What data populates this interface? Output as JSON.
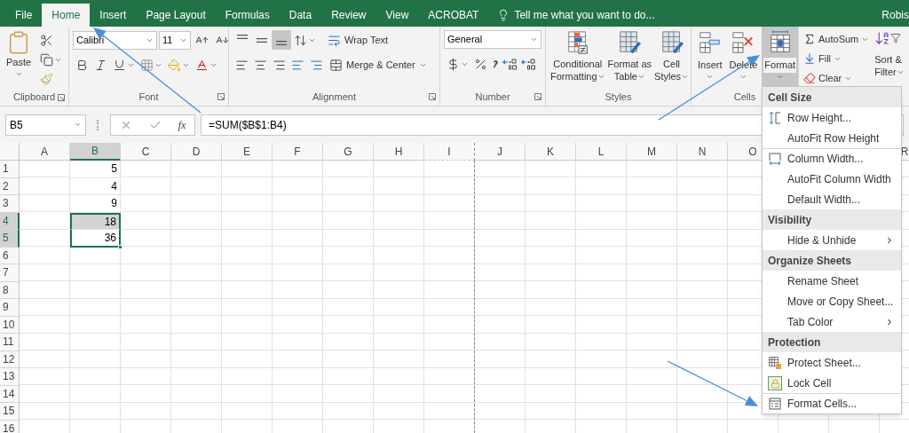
{
  "tabs": [
    {
      "label": "File",
      "selected": false
    },
    {
      "label": "Home",
      "selected": true
    },
    {
      "label": "Insert",
      "selected": false
    },
    {
      "label": "Page Layout",
      "selected": false
    },
    {
      "label": "Formulas",
      "selected": false
    },
    {
      "label": "Data",
      "selected": false
    },
    {
      "label": "Review",
      "selected": false
    },
    {
      "label": "View",
      "selected": false
    },
    {
      "label": "ACROBAT",
      "selected": false
    }
  ],
  "tell_me": {
    "placeholder": "Tell me what you want to do..."
  },
  "user": "Robis",
  "ribbon": {
    "clipboard": {
      "label": "Clipboard",
      "paste": "Paste"
    },
    "font": {
      "label": "Font",
      "font_name": "Calibri",
      "font_size": "11"
    },
    "alignment": {
      "label": "Alignment",
      "wrap_text": "Wrap Text",
      "merge": "Merge & Center",
      "vertical_align": [
        {
          "selected": false
        },
        {
          "selected": false
        },
        {
          "selected": true
        }
      ]
    },
    "number": {
      "label": "Number",
      "format": "General"
    },
    "styles": {
      "label": "Styles",
      "buttons": [
        {
          "lines": [
            "Conditional",
            "Formatting"
          ]
        },
        {
          "lines": [
            "Format as",
            "Table"
          ]
        },
        {
          "lines": [
            "Cell",
            "Styles"
          ]
        }
      ]
    },
    "cells": {
      "label": "Cells",
      "buttons": [
        {
          "label": "Insert",
          "selected": false
        },
        {
          "label": "Delete",
          "selected": false
        },
        {
          "label": "Format",
          "selected": true
        }
      ]
    },
    "editing": {
      "buttons": [
        {
          "label": "AutoSum"
        },
        {
          "label": "Fill"
        },
        {
          "label": "Clear"
        }
      ],
      "sort_filter": [
        "Sort &",
        "Filter"
      ]
    }
  },
  "formula_bar": {
    "name_box": "B5",
    "function_label": "fx",
    "formula": "=SUM($B$1:B4)"
  },
  "sheet": {
    "columns": [
      {
        "letter": "A",
        "selected": false,
        "page_break_after": false
      },
      {
        "letter": "B",
        "selected": true,
        "page_break_after": false
      },
      {
        "letter": "C",
        "selected": false,
        "page_break_after": false
      },
      {
        "letter": "D",
        "selected": false,
        "page_break_after": false
      },
      {
        "letter": "E",
        "selected": false,
        "page_break_after": false
      },
      {
        "letter": "F",
        "selected": false,
        "page_break_after": false
      },
      {
        "letter": "G",
        "selected": false,
        "page_break_after": false
      },
      {
        "letter": "H",
        "selected": false,
        "page_break_after": false
      },
      {
        "letter": "I",
        "selected": false,
        "page_break_after": true
      },
      {
        "letter": "J",
        "selected": false,
        "page_break_after": false
      },
      {
        "letter": "K",
        "selected": false,
        "page_break_after": false
      },
      {
        "letter": "L",
        "selected": false,
        "page_break_after": false
      },
      {
        "letter": "M",
        "selected": false,
        "page_break_after": false
      },
      {
        "letter": "N",
        "selected": false,
        "page_break_after": false
      },
      {
        "letter": "O",
        "selected": false,
        "page_break_after": false
      },
      {
        "letter": "R",
        "selected": false,
        "page_break_after": false
      }
    ],
    "rows": [
      {
        "number": "1",
        "b": "5",
        "selected": false,
        "active": false
      },
      {
        "number": "2",
        "b": "4",
        "selected": false,
        "active": false
      },
      {
        "number": "3",
        "b": "9",
        "selected": false,
        "active": false
      },
      {
        "number": "4",
        "b": "18",
        "selected": true,
        "active": false
      },
      {
        "number": "5",
        "b": "36",
        "selected": true,
        "active": true
      },
      {
        "number": "6",
        "selected": false,
        "active": false
      },
      {
        "number": "7",
        "selected": false,
        "active": false
      },
      {
        "number": "8",
        "selected": false,
        "active": false
      },
      {
        "number": "9",
        "selected": false,
        "active": false
      },
      {
        "number": "10",
        "selected": false,
        "active": false
      },
      {
        "number": "11",
        "selected": false,
        "active": false
      },
      {
        "number": "12",
        "selected": false,
        "active": false
      },
      {
        "number": "13",
        "selected": false,
        "active": false
      },
      {
        "number": "14",
        "selected": false,
        "active": false
      },
      {
        "number": "15",
        "selected": false,
        "active": false
      },
      {
        "number": "16",
        "selected": false,
        "active": false
      }
    ]
  },
  "format_menu": {
    "sections": [
      {
        "title": "Cell Size",
        "items": [
          {
            "label": "Row Height...",
            "submenu": false,
            "separator_above": false
          },
          {
            "label": "AutoFit Row Height",
            "submenu": false,
            "separator_above": false
          },
          {
            "label": "Column Width...",
            "submenu": false,
            "separator_above": true
          },
          {
            "label": "AutoFit Column Width",
            "submenu": false,
            "separator_above": false
          },
          {
            "label": "Default Width...",
            "submenu": false,
            "separator_above": false
          }
        ]
      },
      {
        "title": "Visibility",
        "items": [
          {
            "label": "Hide & Unhide",
            "submenu": true,
            "separator_above": false
          }
        ]
      },
      {
        "title": "Organize Sheets",
        "items": [
          {
            "label": "Rename Sheet",
            "submenu": false,
            "separator_above": false
          },
          {
            "label": "Move or Copy Sheet...",
            "submenu": false,
            "separator_above": false
          },
          {
            "label": "Tab Color",
            "submenu": true,
            "separator_above": false
          }
        ]
      },
      {
        "title": "Protection",
        "items": [
          {
            "label": "Protect Sheet...",
            "submenu": false,
            "separator_above": false
          },
          {
            "label": "Lock Cell",
            "submenu": false,
            "separator_above": false
          },
          {
            "label": "Format Cells...",
            "submenu": false,
            "separator_above": true
          }
        ]
      }
    ]
  }
}
